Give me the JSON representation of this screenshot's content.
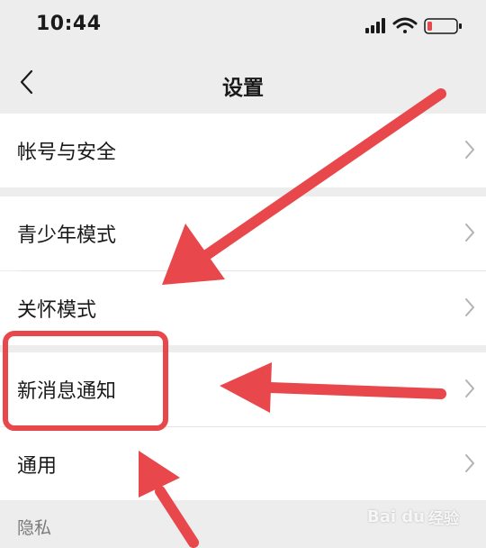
{
  "status_bar": {
    "time": "10:44",
    "icons": [
      "cellular-signal-icon",
      "wifi-icon",
      "battery-low-icon"
    ],
    "battery_color": "#e5484d"
  },
  "nav": {
    "back_icon": "chevron-left-icon",
    "title": "设置"
  },
  "settings": {
    "groups": [
      {
        "items": [
          {
            "label": "帐号与安全"
          }
        ]
      },
      {
        "items": [
          {
            "label": "青少年模式"
          },
          {
            "label": "关怀模式"
          }
        ]
      },
      {
        "items": [
          {
            "label": "新消息通知",
            "highlighted": true
          },
          {
            "label": "通用"
          }
        ]
      }
    ],
    "section_header": "隐私"
  },
  "annotations": {
    "arrow_color": "#e8474c",
    "highlight_color": "#e8474c",
    "arrows": 3
  },
  "watermark": {
    "logo": "Bai du",
    "sub": "经验"
  }
}
